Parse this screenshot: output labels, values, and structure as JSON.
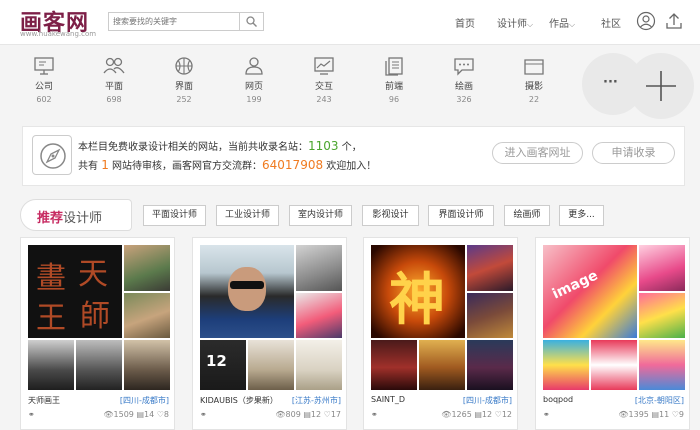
{
  "header": {
    "logo_text": "画客网",
    "logo_url_text": "www.huakewang.com",
    "search_placeholder": "搜索要找的关键字",
    "nav": [
      "首页",
      "设计师",
      "作品",
      "社区"
    ],
    "nav_dropdown_glyph": "⌵"
  },
  "categories": [
    {
      "label": "公司",
      "count": "602",
      "icon": "monitor-stand-icon"
    },
    {
      "label": "平面",
      "count": "698",
      "icon": "people-icon"
    },
    {
      "label": "界面",
      "count": "252",
      "icon": "basketball-icon"
    },
    {
      "label": "网页",
      "count": "199",
      "icon": "user-icon"
    },
    {
      "label": "交互",
      "count": "243",
      "icon": "chart-monitor-icon"
    },
    {
      "label": "前端",
      "count": "96",
      "icon": "document-stack-icon"
    },
    {
      "label": "绘画",
      "count": "326",
      "icon": "chat-bubble-icon"
    },
    {
      "label": "摄影",
      "count": "22",
      "icon": "folder-icon"
    }
  ],
  "more_glyph": "···",
  "notice": {
    "line1_pre": "本栏目免费收录设计相关的网站，当前共收录名站：",
    "line1_num": "1103",
    "line1_post": " 个，",
    "line2_pre": "共有 ",
    "line2_num": "1",
    "line2_mid": " 网站待审核，画客网官方交流群：",
    "line2_group": "64017908",
    "line2_post": " 欢迎加入！",
    "btn_enter": "进入画客网址",
    "btn_apply": "申请收录"
  },
  "designers": {
    "head_strong": "推荐",
    "head_rest": "设计师",
    "tags": [
      "平面设计师",
      "工业设计师",
      "室内设计师",
      "影视设计",
      "界面设计师",
      "绘画师",
      "更多..."
    ]
  },
  "cards": [
    {
      "name": "天师画王",
      "location": "[四川-成都市]",
      "views": "1509",
      "works": "14",
      "likes": "8"
    },
    {
      "name": "KIDAUBIS（步果新）",
      "location": "[江苏-苏州市]",
      "views": "809",
      "works": "12",
      "likes": "17"
    },
    {
      "name": "SAINT_D",
      "location": "[四川-成都市]",
      "views": "1265",
      "works": "12",
      "likes": "12"
    },
    {
      "name": "boqpod",
      "location": "[北京-朝阳区]",
      "views": "1395",
      "works": "11",
      "likes": "9"
    }
  ],
  "card_art": {
    "calligraphy": [
      "畫",
      "天",
      "王",
      "師"
    ],
    "shen": "神",
    "image_label": "image",
    "clock_time": "12"
  },
  "colors": {
    "brand": "#7d1f47",
    "accent_pink": "#c72a61",
    "count_green": "#4aa52e",
    "count_orange": "#f07b20",
    "location_blue": "#3a7bc8"
  }
}
